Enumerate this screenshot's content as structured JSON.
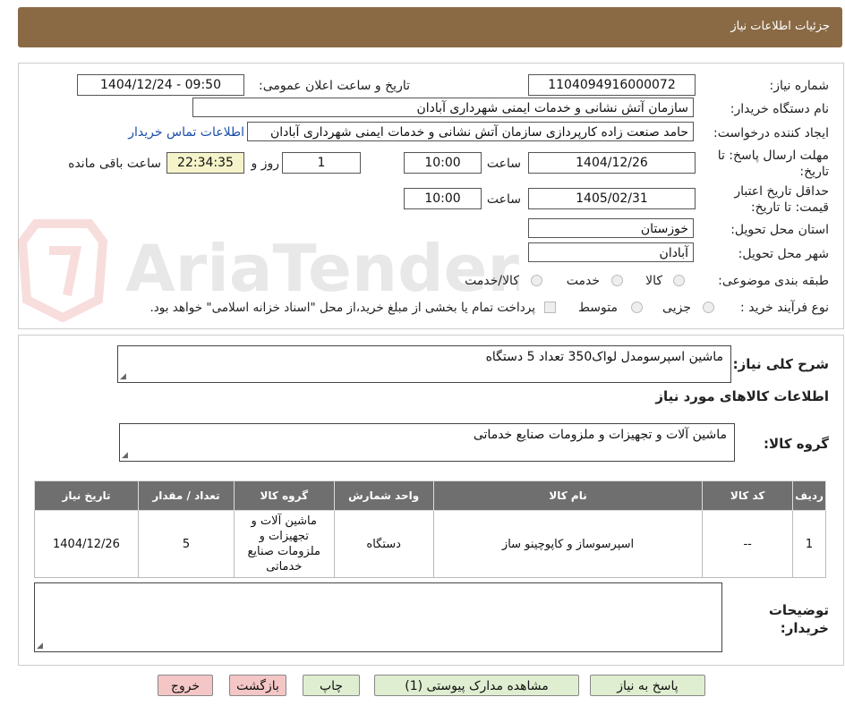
{
  "header": {
    "title": "جزئیات اطلاعات نیاز"
  },
  "watermark": {
    "text": "AriaTender.neT"
  },
  "form": {
    "need_number_label": "شماره نیاز:",
    "need_number": "1104094916000072",
    "announce_label": "تاریخ و ساعت اعلان عمومی:",
    "announce_value": "1404/12/24 - 09:50",
    "buyer_org_label": "نام دستگاه خریدار:",
    "buyer_org": "سازمان آتش نشانی و خدمات ایمنی شهرداری آبادان",
    "requester_label": "ایجاد کننده درخواست:",
    "requester": "حامد صنعت زاده کارپردازی سازمان آتش نشانی و خدمات ایمنی شهرداری آبادان",
    "contact_link": "اطلاعات تماس خریدار",
    "deadline_label": "مهلت ارسال پاسخ: تا تاریخ:",
    "deadline_date": "1404/12/26",
    "time_label": "ساعت",
    "deadline_time": "10:00",
    "days": "1",
    "days_label": "روز و",
    "remaining_time": "22:34:35",
    "remaining_label": "ساعت باقی مانده",
    "validity_label": "حداقل تاریخ اعتبار قیمت: تا تاریخ:",
    "validity_date": "1405/02/31",
    "validity_time": "10:00",
    "province_label": "استان محل تحویل:",
    "province": "خوزستان",
    "city_label": "شهر محل تحویل:",
    "city": "آبادان",
    "category_label": "طبقه بندی موضوعی:",
    "category_options": [
      "کالا",
      "خدمت",
      "کالا/خدمت"
    ],
    "process_label": "نوع فرآیند خرید :",
    "process_options": [
      "جزیی",
      "متوسط"
    ],
    "payment_note": "پرداخت تمام یا بخشی از مبلغ خرید،از محل \"اسناد خزانه اسلامی\" خواهد بود."
  },
  "summary": {
    "label": "شرح کلی نیاز:",
    "value": "ماشین اسپرسومدل لواک350 تعداد 5 دستگاه"
  },
  "goods_info_title": "اطلاعات کالاهای مورد نیاز",
  "goods_group": {
    "label": "گروه کالا:",
    "value": "ماشین آلات و تجهیزات و ملزومات صنایع خدماتی"
  },
  "table": {
    "headers": [
      "ردیف",
      "کد کالا",
      "نام کالا",
      "واحد شمارش",
      "گروه کالا",
      "تعداد / مقدار",
      "تاریخ نیاز"
    ],
    "rows": [
      [
        "1",
        "--",
        "اسپرسوساز و کاپوچینو ساز",
        "دستگاه",
        "ماشین آلات و تجهیزات و ملزومات صنایع خدماتی",
        "5",
        "1404/12/26"
      ]
    ]
  },
  "buyer_notes": {
    "label": "توضیحات خریدار:",
    "value": ""
  },
  "buttons": {
    "reply": "پاسخ به نیاز",
    "attachments": "مشاهده مدارک پیوستی (1)",
    "print": "چاپ",
    "back": "بازگشت",
    "exit": "خروج"
  }
}
